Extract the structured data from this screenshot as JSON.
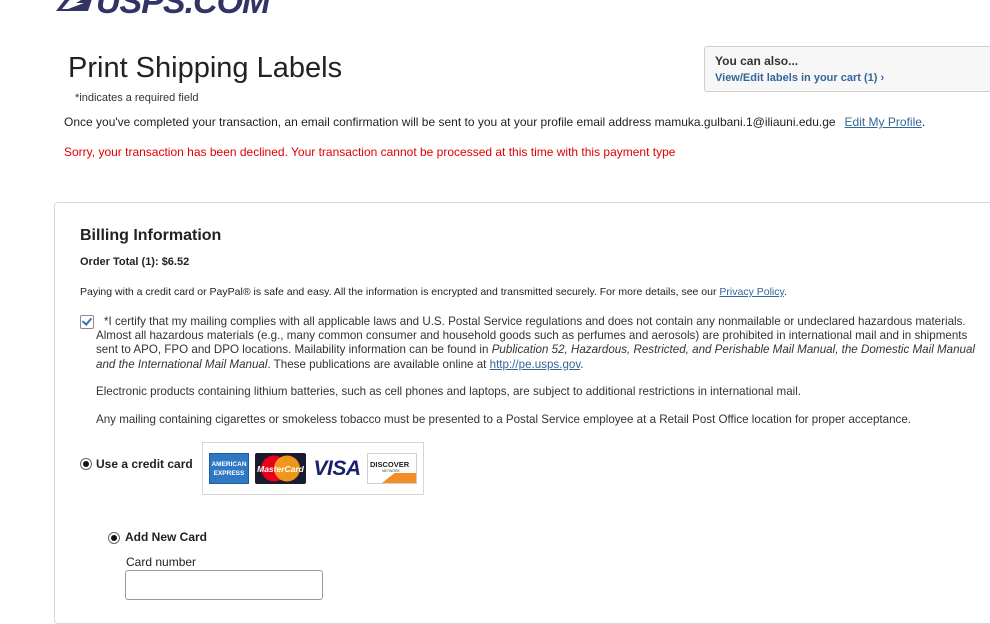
{
  "header": {
    "logo_text": "USPS.COM"
  },
  "page": {
    "title": "Print Shipping Labels",
    "required_note": "*indicates a required field"
  },
  "also": {
    "title": "You can also...",
    "link": "View/Edit labels in your cart (1) ›"
  },
  "confirmation": {
    "text": "Once you've completed your transaction, an email confirmation will be sent to you at your profile email address mamuka.gulbani.1@iliauni.edu.ge",
    "edit_link": "Edit My Profile",
    "period": "."
  },
  "error": {
    "text": "Sorry, your transaction has been declined. Your transaction cannot be processed at this time with this payment type"
  },
  "billing": {
    "title": "Billing Information",
    "order_total": "Order Total (1): $6.52",
    "safe_text": "Paying with a credit card or PayPal® is safe and easy. All the information is encrypted and transmitted securely. For more details, see our",
    "privacy_link": "Privacy Policy",
    "period": "."
  },
  "certify": {
    "checked": true,
    "text_a": "*I certify that my mailing complies with all applicable laws and U.S. Postal Service regulations and does not contain any nonmailable or undeclared hazardous materials. Almost all hazardous materials (e.g., many common consumer and household goods such as perfumes and aerosols) are prohibited in international mail and in shipments sent to APO, FPO and DPO locations. Mailability information can be found in",
    "publication": "Publication 52, Hazardous, Restricted, and Perishable Mail Manual, the Domestic Mail Manual and the International Mail Manual",
    "text_b": ". These publications are available online at",
    "link": "http://pe.usps.gov",
    "period": "."
  },
  "notes": {
    "lithium": "Electronic products containing lithium batteries, such as cell phones and laptops, are subject to additional restrictions in international mail.",
    "tobacco": "Any mailing containing cigarettes or smokeless tobacco must be presented to a Postal Service employee at a Retail Post Office location for proper acceptance."
  },
  "payment": {
    "credit_label": "Use a credit card",
    "credit_selected": true,
    "card_logos": {
      "amex": "AMERICAN EXPRESS",
      "mastercard": "MasterCard",
      "visa": "VISA",
      "discover": "DISCOVER",
      "discover_sub": "NETWORK"
    },
    "new_card_label": "Add New Card",
    "new_card_selected": true,
    "card_number_label": "Card number",
    "card_number_value": ""
  },
  "colors": {
    "link": "#336699",
    "error": "#e00000",
    "brand": "#333366"
  }
}
